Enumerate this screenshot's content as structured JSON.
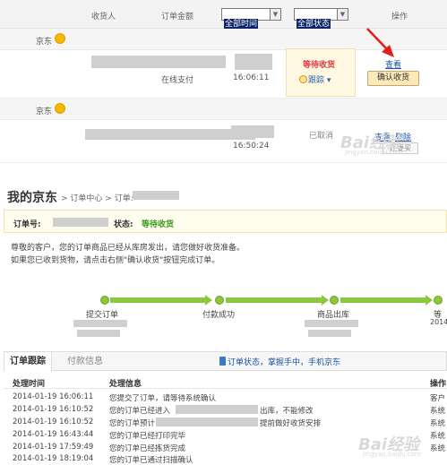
{
  "orders_header": {
    "recipient": "收货人",
    "amount": "订单金额",
    "time_filter": "全部时间",
    "status_filter": "全部状态",
    "action": "操作"
  },
  "orders": [
    {
      "store": "京东",
      "payment": "在线支付",
      "time": "16:06:11",
      "status": "等待收货",
      "track": "跟踪",
      "view": "查看",
      "confirm": "确认收货"
    },
    {
      "store": "京东",
      "time": "16:50:24",
      "status": "已取消",
      "view": "查看",
      "delete": "删除",
      "rebuy": "还要买"
    }
  ],
  "page": {
    "title": "我的京东",
    "breadcrumb": [
      "订单中心",
      "订单:"
    ]
  },
  "order_info": {
    "order_no_label": "订单号:",
    "status_label": "状态:",
    "status_value": "等待收货"
  },
  "notice": {
    "line1": "尊敬的客户，您的订单商品已经从库房发出，请您做好收货准备。",
    "line2": "如果您已收到货物，请点击右侧\"确认收货\"按钮完成订单。"
  },
  "progress": {
    "steps": [
      "提交订单",
      "付款成功",
      "商品出库",
      "等"
    ],
    "step_dates": [
      "2014"
    ]
  },
  "tabs": {
    "track": "订单跟踪",
    "payment": "付款信息",
    "promo": "订单状态，掌握手中，手机京东"
  },
  "log_table": {
    "headers": [
      "处理时间",
      "处理信息",
      "操作"
    ],
    "rows": [
      {
        "time": "2014-01-19 16:06:11",
        "info": "您提交了订单，请等待系统确认",
        "op": "客户"
      },
      {
        "time": "2014-01-19 16:10:52",
        "info": "您的订单已经进入",
        "info2": "出库，不能修改",
        "op": "系统"
      },
      {
        "time": "2014-01-19 16:10:52",
        "info": "您的订单预计",
        "info2": "提前做好收货安排",
        "op": "系统"
      },
      {
        "time": "2014-01-19 16:43:44",
        "info": "您的订单已经打印完毕",
        "op": "系统"
      },
      {
        "time": "2014-01-19 17:59:49",
        "info": "您的订单已经拣货完成",
        "op": "系统"
      },
      {
        "time": "2014-01-19 18:19:04",
        "info": "您的订单已通过扫描确认",
        "op": ""
      }
    ]
  },
  "watermark": {
    "text": "Bai经验",
    "sub": "jingyan.baidu.com"
  },
  "colors": {
    "accent_red": "#e4393c",
    "link_blue": "#1a54a8",
    "progress_green": "#8dc63f",
    "status_bg": "#fff9e3"
  }
}
